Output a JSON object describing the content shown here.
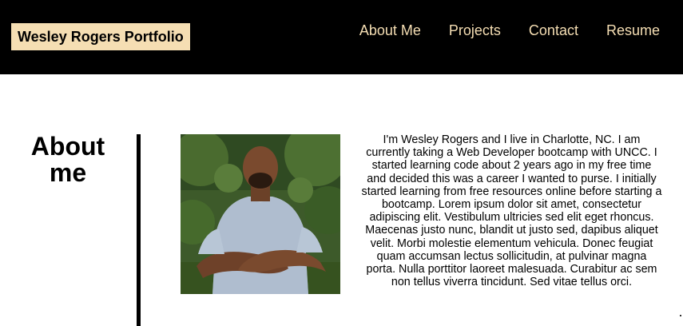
{
  "header": {
    "brand": "Wesley Rogers Portfolio",
    "nav": [
      "About Me",
      "Projects",
      "Contact",
      "Resume"
    ]
  },
  "about": {
    "title": "About me",
    "bio": "I'm Wesley Rogers and I live in Charlotte, NC. I am currently taking a Web Developer bootcamp with UNCC. I started learning code about 2 years ago in my free time and decided this was a career I wanted to purse. I initially started learning from free resources online before starting a bootcamp. Lorem ipsum dolor sit amet, consectetur adipiscing elit. Vestibulum ultricies sed elit eget rhoncus. Maecenas justo nunc, blandit ut justo sed, dapibus aliquet velit. Morbi molestie elementum vehicula. Donec feugiat quam accumsan lectus sollicitudin, at pulvinar magna porta. Nulla porttitor laoreet malesuada. Curabitur ac sem non tellus viverra tincidunt. Sed vitae tellus orci."
  },
  "colors": {
    "header_bg": "#000000",
    "accent": "#f5deb3"
  }
}
